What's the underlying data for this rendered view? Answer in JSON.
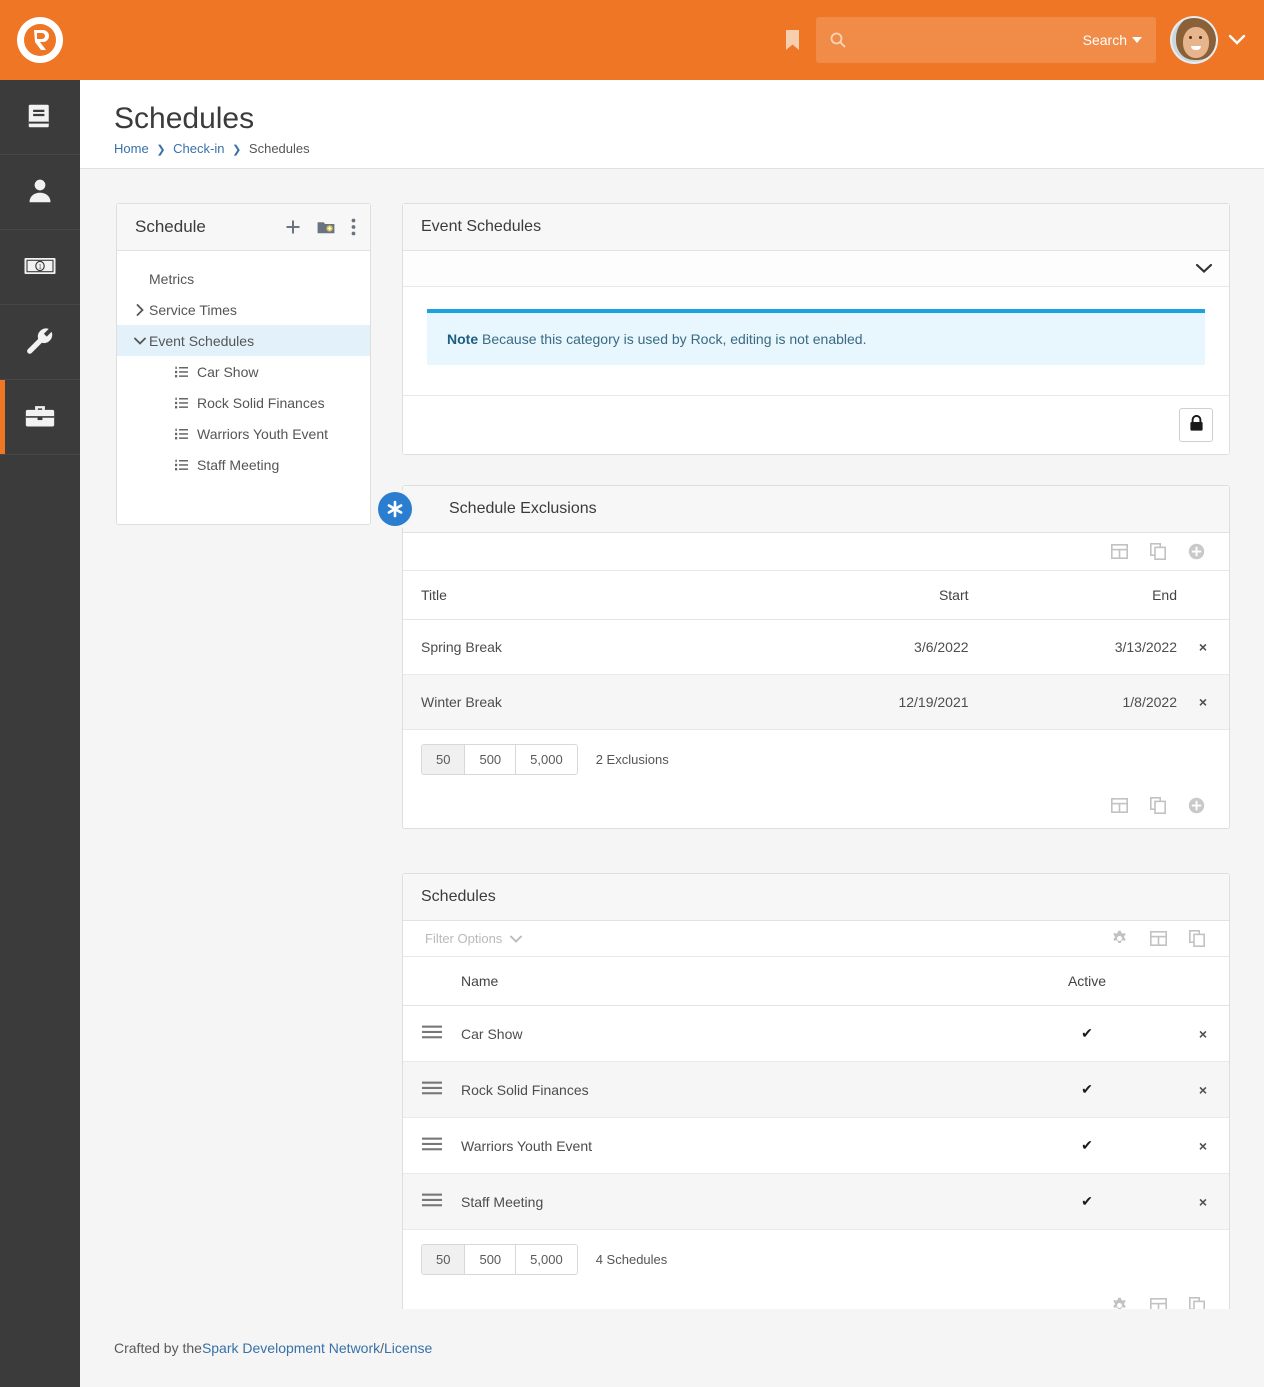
{
  "topbar": {
    "logo_name": "rock-rms-logo",
    "bookmark_icon": "bookmark-icon",
    "search": {
      "placeholder": "",
      "value": "",
      "label": "Search",
      "icon": "search-icon"
    },
    "avatar_alt": "user-avatar",
    "accent_color": "#ee7624"
  },
  "rail": {
    "items": [
      {
        "icon": "book-icon",
        "name": "cms-nav"
      },
      {
        "icon": "person-icon",
        "name": "people-nav"
      },
      {
        "icon": "money-bill-icon",
        "name": "finance-nav"
      },
      {
        "icon": "wrench-icon",
        "name": "admin-tools-nav"
      },
      {
        "icon": "briefcase-icon",
        "name": "tools-nav",
        "active": true
      }
    ]
  },
  "page": {
    "title": "Schedules",
    "breadcrumb": [
      {
        "label": "Home",
        "link": true
      },
      {
        "label": "Check-in",
        "link": true
      },
      {
        "label": "Schedules",
        "link": false
      }
    ]
  },
  "tree_panel": {
    "title": "Schedule",
    "actions": [
      {
        "name": "add-item-button",
        "icon": "plus-icon"
      },
      {
        "name": "add-folder-button",
        "icon": "folder-plus-icon"
      },
      {
        "name": "tree-options-button",
        "icon": "ellipsis-vertical-icon"
      }
    ],
    "items": [
      {
        "label": "Metrics",
        "level": 1,
        "toggle": "none",
        "selected": false
      },
      {
        "label": "Service Times",
        "level": 1,
        "toggle": "collapsed",
        "selected": false
      },
      {
        "label": "Event Schedules",
        "level": 1,
        "toggle": "expanded",
        "selected": true
      },
      {
        "label": "Car Show",
        "level": 2,
        "icon": "list-ol-icon",
        "selected": false
      },
      {
        "label": "Rock Solid Finances",
        "level": 2,
        "icon": "list-ol-icon",
        "selected": false
      },
      {
        "label": "Warriors Youth Event",
        "level": 2,
        "icon": "list-ol-icon",
        "selected": false
      },
      {
        "label": "Staff Meeting",
        "level": 2,
        "icon": "list-ol-icon",
        "selected": false
      }
    ]
  },
  "event_schedules_panel": {
    "title": "Event Schedules",
    "collapse_icon": "chevron-down-icon",
    "note_label": "Note",
    "note_text": "Because this category is used by Rock, editing is not enabled.",
    "note_accent_color": "#1aa3e0",
    "lock_button": "lock-icon"
  },
  "exclusions_panel": {
    "badge_icon": "asterisk-icon",
    "badge_color": "#2b7dd0",
    "title": "Schedule Exclusions",
    "toolbar": [
      {
        "name": "grid-view-button",
        "icon": "table-icon"
      },
      {
        "name": "copy-button",
        "icon": "copy-icon"
      },
      {
        "name": "add-exclusion-button",
        "icon": "circle-plus-icon"
      }
    ],
    "columns": [
      "Title",
      "Start",
      "End",
      ""
    ],
    "rows": [
      {
        "title": "Spring Break",
        "start": "3/6/2022",
        "end": "3/13/2022",
        "delete": "×"
      },
      {
        "title": "Winter Break",
        "start": "12/19/2021",
        "end": "1/8/2022",
        "delete": "×"
      }
    ],
    "page_sizes": [
      "50",
      "500",
      "5,000"
    ],
    "active_page_size": "50",
    "count_label": "2 Exclusions"
  },
  "schedules_panel": {
    "title": "Schedules",
    "filter_label": "Filter Options",
    "filter_icon": "chevron-down-icon",
    "toolbar": [
      {
        "name": "settings-button",
        "icon": "gear-icon"
      },
      {
        "name": "grid-view-button",
        "icon": "table-icon"
      },
      {
        "name": "copy-button",
        "icon": "copy-icon"
      }
    ],
    "columns": [
      "",
      "Name",
      "Active",
      ""
    ],
    "rows": [
      {
        "reorder": "reorder-handle",
        "name": "Car Show",
        "active": "✔",
        "delete": "×"
      },
      {
        "reorder": "reorder-handle",
        "name": "Rock Solid Finances",
        "active": "✔",
        "delete": "×"
      },
      {
        "reorder": "reorder-handle",
        "name": "Warriors Youth Event",
        "active": "✔",
        "delete": "×"
      },
      {
        "reorder": "reorder-handle",
        "name": "Staff Meeting",
        "active": "✔",
        "delete": "×"
      }
    ],
    "page_sizes": [
      "50",
      "500",
      "5,000"
    ],
    "active_page_size": "50",
    "count_label": "4 Schedules"
  },
  "footer": {
    "prefix": "Crafted by the ",
    "org_link": "Spark Development Network",
    "separator": " / ",
    "license_link": "License"
  }
}
